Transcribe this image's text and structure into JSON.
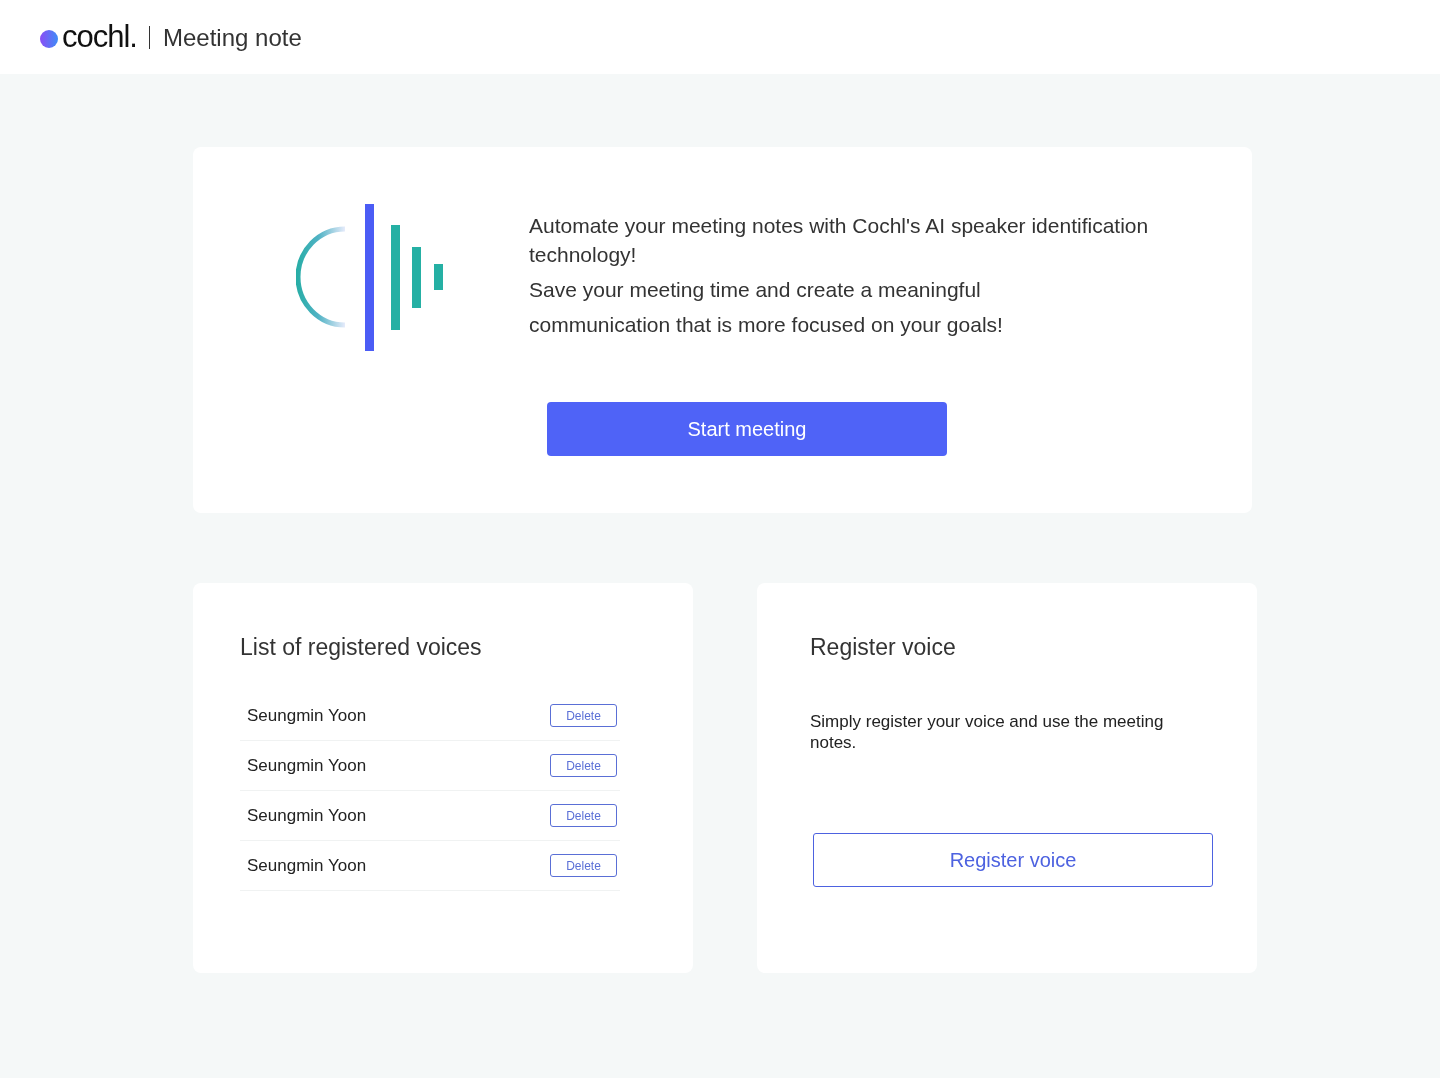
{
  "header": {
    "logo_text": "cochl.",
    "app_title": "Meeting note"
  },
  "hero": {
    "paragraphs": [
      "Automate your meeting notes with Cochl's AI speaker identification technology!",
      "Save your meeting time and create a meaningful communication that is more focused on your goals!"
    ],
    "start_button": "Start meeting"
  },
  "voice_list": {
    "title": "List of registered voices",
    "voices": [
      {
        "name": "Seungmin Yoon",
        "action": "Delete"
      },
      {
        "name": "Seungmin Yoon",
        "action": "Delete"
      },
      {
        "name": "Seungmin Yoon",
        "action": "Delete"
      },
      {
        "name": "Seungmin Yoon",
        "action": "Delete"
      }
    ]
  },
  "register": {
    "title": "Register voice",
    "description": "Simply register your voice and use the meeting notes.",
    "button": "Register voice"
  }
}
